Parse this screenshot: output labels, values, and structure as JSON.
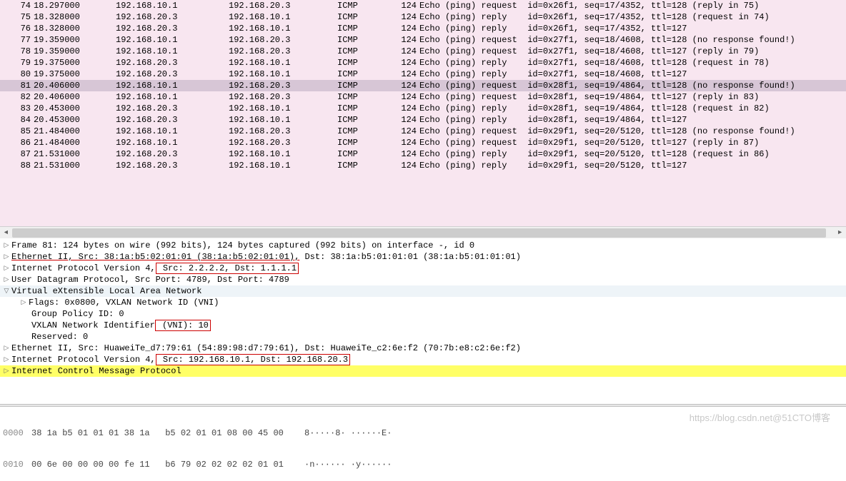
{
  "packets": [
    {
      "no": "74",
      "time": "18.297000",
      "src": "192.168.10.1",
      "dst": "192.168.20.3",
      "proto": "ICMP",
      "len": "124",
      "info": "Echo (ping) request  id=0x26f1, seq=17/4352, ttl=128 (reply in 75)",
      "sel": false
    },
    {
      "no": "75",
      "time": "18.328000",
      "src": "192.168.20.3",
      "dst": "192.168.10.1",
      "proto": "ICMP",
      "len": "124",
      "info": "Echo (ping) reply    id=0x26f1, seq=17/4352, ttl=128 (request in 74)",
      "sel": false
    },
    {
      "no": "76",
      "time": "18.328000",
      "src": "192.168.20.3",
      "dst": "192.168.10.1",
      "proto": "ICMP",
      "len": "124",
      "info": "Echo (ping) reply    id=0x26f1, seq=17/4352, ttl=127",
      "sel": false
    },
    {
      "no": "77",
      "time": "19.359000",
      "src": "192.168.10.1",
      "dst": "192.168.20.3",
      "proto": "ICMP",
      "len": "124",
      "info": "Echo (ping) request  id=0x27f1, seq=18/4608, ttl=128 (no response found!)",
      "sel": false
    },
    {
      "no": "78",
      "time": "19.359000",
      "src": "192.168.10.1",
      "dst": "192.168.20.3",
      "proto": "ICMP",
      "len": "124",
      "info": "Echo (ping) request  id=0x27f1, seq=18/4608, ttl=127 (reply in 79)",
      "sel": false
    },
    {
      "no": "79",
      "time": "19.375000",
      "src": "192.168.20.3",
      "dst": "192.168.10.1",
      "proto": "ICMP",
      "len": "124",
      "info": "Echo (ping) reply    id=0x27f1, seq=18/4608, ttl=128 (request in 78)",
      "sel": false
    },
    {
      "no": "80",
      "time": "19.375000",
      "src": "192.168.20.3",
      "dst": "192.168.10.1",
      "proto": "ICMP",
      "len": "124",
      "info": "Echo (ping) reply    id=0x27f1, seq=18/4608, ttl=127",
      "sel": false
    },
    {
      "no": "81",
      "time": "20.406000",
      "src": "192.168.10.1",
      "dst": "192.168.20.3",
      "proto": "ICMP",
      "len": "124",
      "info": "Echo (ping) request  id=0x28f1, seq=19/4864, ttl=128 (no response found!)",
      "sel": true
    },
    {
      "no": "82",
      "time": "20.406000",
      "src": "192.168.10.1",
      "dst": "192.168.20.3",
      "proto": "ICMP",
      "len": "124",
      "info": "Echo (ping) request  id=0x28f1, seq=19/4864, ttl=127 (reply in 83)",
      "sel": false
    },
    {
      "no": "83",
      "time": "20.453000",
      "src": "192.168.20.3",
      "dst": "192.168.10.1",
      "proto": "ICMP",
      "len": "124",
      "info": "Echo (ping) reply    id=0x28f1, seq=19/4864, ttl=128 (request in 82)",
      "sel": false
    },
    {
      "no": "84",
      "time": "20.453000",
      "src": "192.168.20.3",
      "dst": "192.168.10.1",
      "proto": "ICMP",
      "len": "124",
      "info": "Echo (ping) reply    id=0x28f1, seq=19/4864, ttl=127",
      "sel": false
    },
    {
      "no": "85",
      "time": "21.484000",
      "src": "192.168.10.1",
      "dst": "192.168.20.3",
      "proto": "ICMP",
      "len": "124",
      "info": "Echo (ping) request  id=0x29f1, seq=20/5120, ttl=128 (no response found!)",
      "sel": false
    },
    {
      "no": "86",
      "time": "21.484000",
      "src": "192.168.10.1",
      "dst": "192.168.20.3",
      "proto": "ICMP",
      "len": "124",
      "info": "Echo (ping) request  id=0x29f1, seq=20/5120, ttl=127 (reply in 87)",
      "sel": false
    },
    {
      "no": "87",
      "time": "21.531000",
      "src": "192.168.20.3",
      "dst": "192.168.10.1",
      "proto": "ICMP",
      "len": "124",
      "info": "Echo (ping) reply    id=0x29f1, seq=20/5120, ttl=128 (request in 86)",
      "sel": false
    },
    {
      "no": "88",
      "time": "21.531000",
      "src": "192.168.20.3",
      "dst": "192.168.10.1",
      "proto": "ICMP",
      "len": "124",
      "info": "Echo (ping) reply    id=0x29f1, seq=20/5120, ttl=127",
      "sel": false
    }
  ],
  "detail": {
    "frame": "Frame 81: 124 bytes on wire (992 bits), 124 bytes captured (992 bits) on interface -, id 0",
    "eth1_a": "Ethernet II, Src: 38:1a:b5:02:01:01 (38:1a:b5:02:01:01),",
    "eth1_b": " Dst: 38:1a:b5:01:01:01 (38:1a:b5:01:01:01)",
    "ip1_a": "Internet Protocol Version 4,",
    "ip1_b": " Src: 2.2.2.2, Dst: 1.1.1.1",
    "udp": "User Datagram Protocol, Src Port: 4789, Dst Port: 4789",
    "vxlan_hdr": "Virtual eXtensible Local Area Network",
    "vxlan_flags": "Flags: 0x0800, VXLAN Network ID (VNI)",
    "vxlan_gp": "Group Policy ID: 0",
    "vxlan_vni_a": "VXLAN Network Identifier",
    "vxlan_vni_b": " (VNI): 10",
    "vxlan_res": "Reserved: 0",
    "eth2": "Ethernet II, Src: HuaweiTe_d7:79:61 (54:89:98:d7:79:61), Dst: HuaweiTe_c2:6e:f2 (70:7b:e8:c2:6e:f2)",
    "ip2_a": "Internet Protocol Version 4,",
    "ip2_b": " Src: 192.168.10.1, Dst: 192.168.20.3",
    "icmp": "Internet Control Message Protocol"
  },
  "hex": {
    "l0_off": "0000",
    "l0_bytes": "38 1a b5 01 01 01 38 1a   b5 02 01 01 08 00 45 00",
    "l0_asc": "8·····8· ······E·",
    "l1_off": "0010",
    "l1_bytes": "00 6e 00 00 00 00 fe 11   b6 79 02 02 02 02 01 01",
    "l1_asc": "·n······ ·y······"
  },
  "watermark": "https://blog.csdn.net@51CTO博客"
}
